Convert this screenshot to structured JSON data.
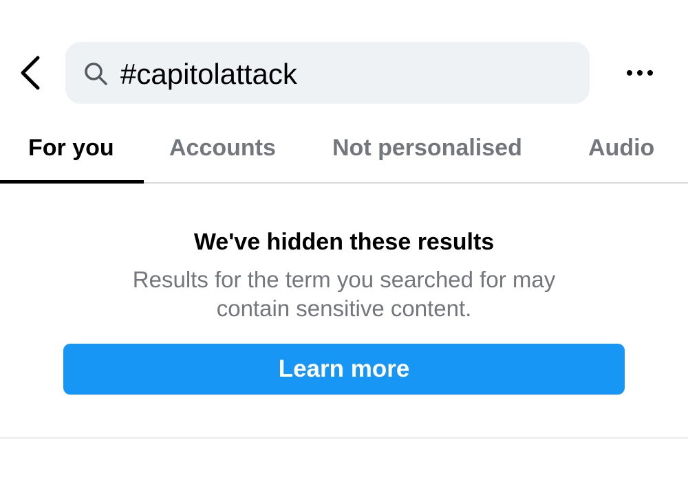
{
  "header": {
    "back_icon": "chevron-left-icon",
    "search": {
      "icon": "search-icon",
      "value": "#capitolattack"
    },
    "more_icon": "more-horizontal-icon"
  },
  "tabs": [
    {
      "label": "For you",
      "active": true
    },
    {
      "label": "Accounts",
      "active": false
    },
    {
      "label": "Not personalised",
      "active": false
    },
    {
      "label": "Audio",
      "active": false
    }
  ],
  "notice": {
    "title": "We've hidden these results",
    "body": "Results for the term you searched for may contain sensitive content.",
    "button_label": "Learn more"
  },
  "colors": {
    "accent": "#1896f5",
    "search_bg": "#eff2f5",
    "muted_text": "#73767b"
  }
}
